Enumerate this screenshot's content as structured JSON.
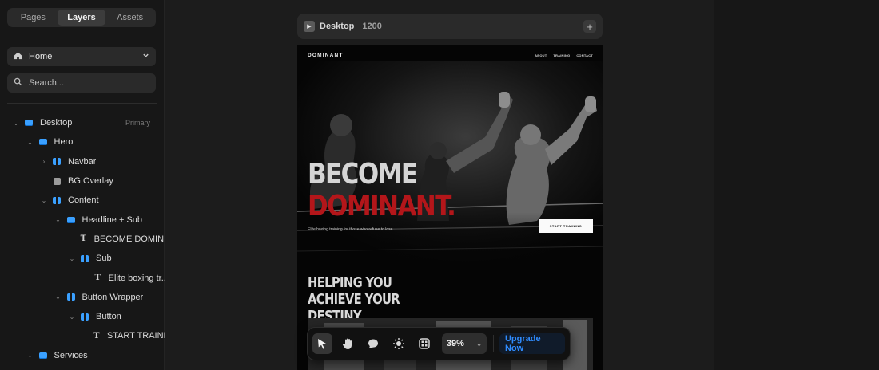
{
  "left_panel": {
    "tabs": [
      {
        "label": "Pages",
        "active": false
      },
      {
        "label": "Layers",
        "active": true
      },
      {
        "label": "Assets",
        "active": false
      }
    ],
    "page_select": {
      "label": "Home",
      "icon": "home-icon"
    },
    "search": {
      "placeholder": "Search..."
    },
    "layers": [
      {
        "name": "Desktop",
        "tag": "Primary",
        "depth": 0,
        "chevron": "down",
        "icon": "stack"
      },
      {
        "name": "Hero",
        "tag": "",
        "depth": 1,
        "chevron": "down",
        "icon": "stack"
      },
      {
        "name": "Navbar",
        "tag": "",
        "depth": 2,
        "chevron": "right",
        "icon": "cols"
      },
      {
        "name": "BG Overlay",
        "tag": "",
        "depth": 2,
        "chevron": "",
        "icon": "box"
      },
      {
        "name": "Content",
        "tag": "",
        "depth": 2,
        "chevron": "down",
        "icon": "cols"
      },
      {
        "name": "Headline + Sub",
        "tag": "",
        "depth": 3,
        "chevron": "down",
        "icon": "stack"
      },
      {
        "name": "BECOME DOMIN...",
        "tag": "",
        "depth": 4,
        "chevron": "",
        "icon": "text"
      },
      {
        "name": "Sub",
        "tag": "",
        "depth": 4,
        "chevron": "down",
        "icon": "cols"
      },
      {
        "name": "Elite boxing tr...",
        "tag": "",
        "depth": 5,
        "chevron": "",
        "icon": "text"
      },
      {
        "name": "Button Wrapper",
        "tag": "",
        "depth": 3,
        "chevron": "down",
        "icon": "cols"
      },
      {
        "name": "Button",
        "tag": "",
        "depth": 4,
        "chevron": "down",
        "icon": "cols"
      },
      {
        "name": "START TRAINI...",
        "tag": "",
        "depth": 5,
        "chevron": "",
        "icon": "text"
      },
      {
        "name": "Services",
        "tag": "",
        "depth": 1,
        "chevron": "down",
        "icon": "stack"
      }
    ]
  },
  "frame": {
    "title": "Desktop",
    "width_label": "1200"
  },
  "site": {
    "logo": "DOMINANT",
    "nav": [
      "ABOUT",
      "TRAINING",
      "CONTACT"
    ],
    "headline_1": "BECOME",
    "headline_2": "DOMINANT.",
    "sub": "Elite boxing training for those who refuse to lose.",
    "cta": "START TRAINING",
    "section_title": "HELPING YOU ACHIEVE YOUR DESTINY"
  },
  "toolbar": {
    "zoom": "39%",
    "upgrade": "Upgrade Now",
    "tools": [
      "cursor-icon",
      "hand-icon",
      "comment-icon",
      "sun-icon",
      "grid-icon"
    ]
  },
  "colors": {
    "accent": "#2f8cff",
    "brand_red": "#b3161a",
    "layer_blue": "#3aa0ff"
  }
}
